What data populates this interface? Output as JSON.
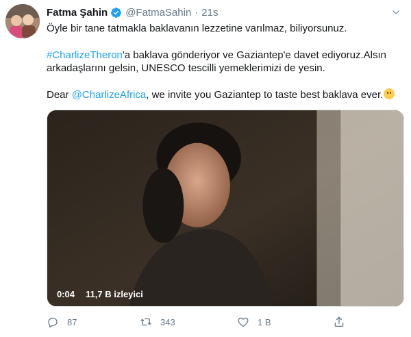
{
  "author": {
    "name": "Fatma Şahin",
    "handle": "@FatmaSahin",
    "separator": "·",
    "time": "21s"
  },
  "tweet": {
    "line1": "Öyle bir tane tatmakla baklavanın lezzetine varılmaz, biliyorsunuz.",
    "hashtag": "#CharlizeTheron",
    "line2_rest": "'a baklava gönderiyor ve Gaziantep'e davet ediyoruz.Alsın arkadaşlarını gelsin, UNESCO tescilli yemeklerimizi de yesin.",
    "line3_prefix": "Dear ",
    "mention": "@CharlizeAfrica",
    "line3_rest": ", we invite you Gaziantep to taste best baklava ever.",
    "emoji": "slightly-smiling-face"
  },
  "video": {
    "time": "0:04",
    "views": "11,7 B izleyici"
  },
  "actions": {
    "replies": "87",
    "retweets": "343",
    "likes": "1 B"
  },
  "colors": {
    "link": "#1da1f2",
    "muted": "#657786",
    "verified": "#1da1f2"
  }
}
